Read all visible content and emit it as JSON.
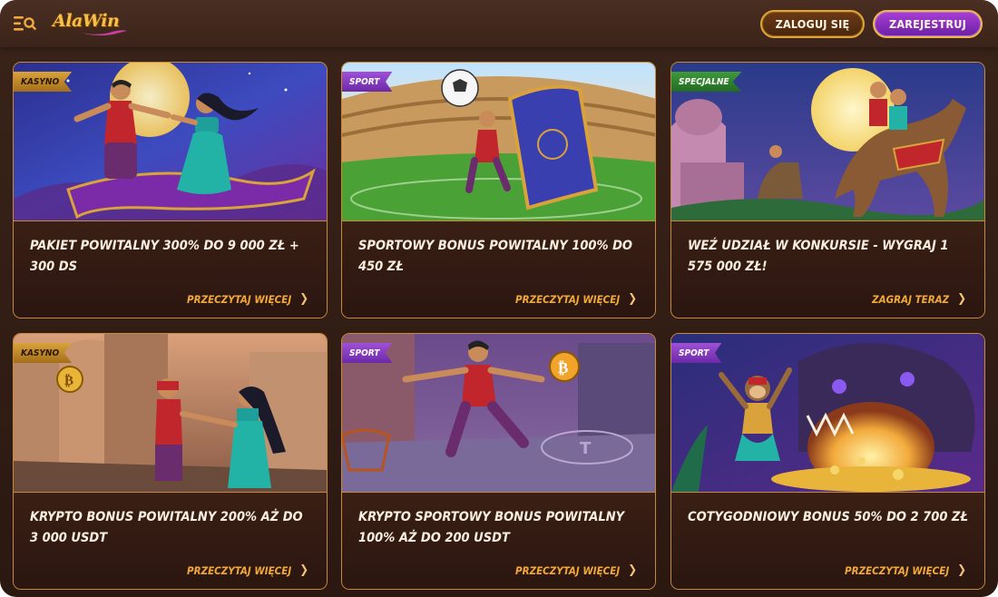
{
  "header": {
    "logo_text": "AlaWin",
    "login_label": "ZALOGUJ SIĘ",
    "register_label": "ZAREJESTRUJ"
  },
  "colors": {
    "accent_gold": "#f2a93b",
    "register_purple": "#a83fd6",
    "badge_kasyno": "#d9a23b",
    "badge_sport": "#a050d8",
    "badge_specjalne": "#3f9a3a"
  },
  "promotions": [
    {
      "badge": "KASYNO",
      "title": "PAKIET POWITALNY 300% DO 9 000 ZŁ + 300 DS",
      "link": "PRZECZYTAJ WIĘCEJ"
    },
    {
      "badge": "SPORT",
      "title": "SPORTOWY BONUS POWITALNY 100% DO 450 ZŁ",
      "link": "PRZECZYTAJ WIĘCEJ"
    },
    {
      "badge": "SPECJALNE",
      "title": "WEŹ UDZIAŁ W KONKURSIE - WYGRAJ 1 575 000 ZŁ!",
      "link": "ZAGRAJ TERAZ"
    },
    {
      "badge": "KASYNO",
      "title": "KRYPTO BONUS POWITALNY 200% AŻ DO 3 000 USDT",
      "link": "PRZECZYTAJ WIĘCEJ"
    },
    {
      "badge": "SPORT",
      "title": "KRYPTO SPORTOWY BONUS POWITALNY 100% AŻ DO 200 USDT",
      "link": "PRZECZYTAJ WIĘCEJ"
    },
    {
      "badge": "SPORT",
      "title": "COTYGODNIOWY BONUS 50% DO 2 700 ZŁ",
      "link": "PRZECZYTAJ WIĘCEJ"
    }
  ]
}
